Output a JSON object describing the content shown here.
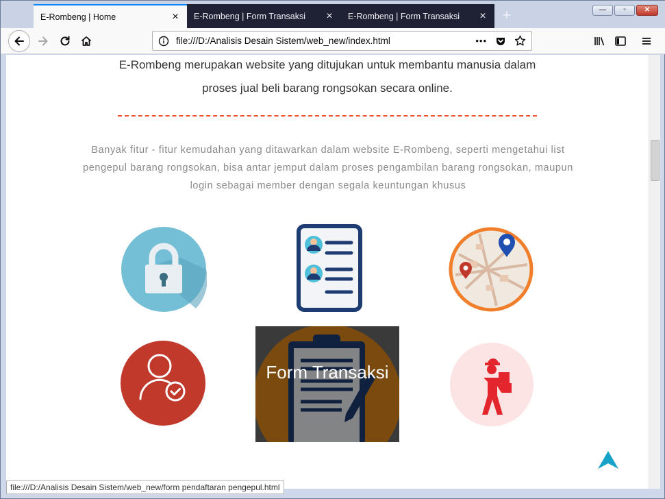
{
  "tabs": [
    {
      "title": "E-Rombeng | Home",
      "active": true
    },
    {
      "title": "E-Rombeng | Form Transaksi",
      "active": false
    },
    {
      "title": "E-Rombeng | Form Transaksi",
      "active": false
    }
  ],
  "toolbar": {
    "url": "file:///D:/Analisis Desain Sistem/web_new/index.html",
    "more_label": "•••"
  },
  "page": {
    "intro_line1": "E-Rombeng merupakan website yang ditujukan untuk membantu manusia dalam",
    "intro_line2": "proses jual beli barang rongsokan secara online.",
    "description": "Banyak fitur - fitur kemudahan yang ditawarkan dalam website E-Rombeng, seperti mengetahui list pengepul barang rongsokan, bisa antar jemput dalam proses pengambilan barang rongsokan, maupun login sebagai member dengan segala keuntungan khusus",
    "overlay_label": "Form Transaksi"
  },
  "features": [
    {
      "icon": "lock-icon"
    },
    {
      "icon": "member-list-icon"
    },
    {
      "icon": "map-pin-icon"
    },
    {
      "icon": "user-check-icon"
    },
    {
      "icon": "form-transaction-icon"
    },
    {
      "icon": "delivery-person-icon"
    }
  ],
  "status": {
    "link": "file:///D:/Analisis Desain Sistem/web_new/form pendaftaran pengepul.html"
  },
  "colors": {
    "accent": "#0a84ff",
    "dash": "#f0532f",
    "lock_bg": "#74bfd6",
    "user_bg": "#c0392b",
    "delivery_bg": "#fde4e4",
    "to_top": "#17a2c8"
  }
}
